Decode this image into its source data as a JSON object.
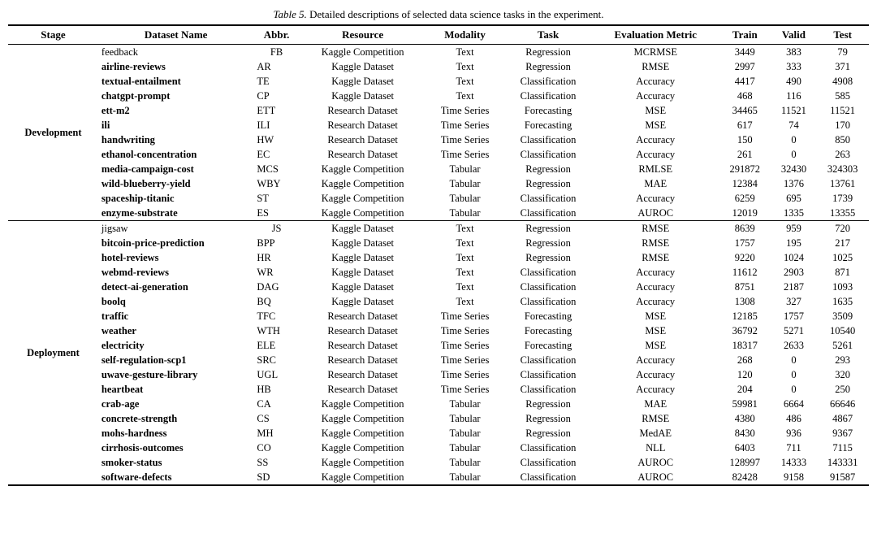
{
  "caption": {
    "table_num": "Table 5.",
    "description": "Detailed descriptions of selected data science tasks in the experiment."
  },
  "headers": [
    "Stage",
    "Dataset Name",
    "Abbr.",
    "Resource",
    "Modality",
    "Task",
    "Evaluation Metric",
    "Train",
    "Valid",
    "Test"
  ],
  "development_rows": [
    [
      "feedback",
      "FB",
      "Kaggle Competition",
      "Text",
      "Regression",
      "MCRMSE",
      "3449",
      "383",
      "79"
    ],
    [
      "airline-reviews",
      "AR",
      "Kaggle Dataset",
      "Text",
      "Regression",
      "RMSE",
      "2997",
      "333",
      "371"
    ],
    [
      "textual-entailment",
      "TE",
      "Kaggle Dataset",
      "Text",
      "Classification",
      "Accuracy",
      "4417",
      "490",
      "4908"
    ],
    [
      "chatgpt-prompt",
      "CP",
      "Kaggle Dataset",
      "Text",
      "Classification",
      "Accuracy",
      "468",
      "116",
      "585"
    ],
    [
      "ett-m2",
      "ETT",
      "Research Dataset",
      "Time Series",
      "Forecasting",
      "MSE",
      "34465",
      "11521",
      "11521"
    ],
    [
      "ili",
      "ILI",
      "Research Dataset",
      "Time Series",
      "Forecasting",
      "MSE",
      "617",
      "74",
      "170"
    ],
    [
      "handwriting",
      "HW",
      "Research Dataset",
      "Time Series",
      "Classification",
      "Accuracy",
      "150",
      "0",
      "850"
    ],
    [
      "ethanol-concentration",
      "EC",
      "Research Dataset",
      "Time Series",
      "Classification",
      "Accuracy",
      "261",
      "0",
      "263"
    ],
    [
      "media-campaign-cost",
      "MCS",
      "Kaggle Competition",
      "Tabular",
      "Regression",
      "RMLSE",
      "291872",
      "32430",
      "324303"
    ],
    [
      "wild-blueberry-yield",
      "WBY",
      "Kaggle Competition",
      "Tabular",
      "Regression",
      "MAE",
      "12384",
      "1376",
      "13761"
    ],
    [
      "spaceship-titanic",
      "ST",
      "Kaggle Competition",
      "Tabular",
      "Classification",
      "Accuracy",
      "6259",
      "695",
      "1739"
    ],
    [
      "enzyme-substrate",
      "ES",
      "Kaggle Competition",
      "Tabular",
      "Classification",
      "AUROC",
      "12019",
      "1335",
      "13355"
    ]
  ],
  "deployment_rows": [
    [
      "jigsaw",
      "JS",
      "Kaggle Dataset",
      "Text",
      "Regression",
      "RMSE",
      "8639",
      "959",
      "720"
    ],
    [
      "bitcoin-price-prediction",
      "BPP",
      "Kaggle Dataset",
      "Text",
      "Regression",
      "RMSE",
      "1757",
      "195",
      "217"
    ],
    [
      "hotel-reviews",
      "HR",
      "Kaggle Dataset",
      "Text",
      "Regression",
      "RMSE",
      "9220",
      "1024",
      "1025"
    ],
    [
      "webmd-reviews",
      "WR",
      "Kaggle Dataset",
      "Text",
      "Classification",
      "Accuracy",
      "11612",
      "2903",
      "871"
    ],
    [
      "detect-ai-generation",
      "DAG",
      "Kaggle Dataset",
      "Text",
      "Classification",
      "Accuracy",
      "8751",
      "2187",
      "1093"
    ],
    [
      "boolq",
      "BQ",
      "Kaggle Dataset",
      "Text",
      "Classification",
      "Accuracy",
      "1308",
      "327",
      "1635"
    ],
    [
      "traffic",
      "TFC",
      "Research Dataset",
      "Time Series",
      "Forecasting",
      "MSE",
      "12185",
      "1757",
      "3509"
    ],
    [
      "weather",
      "WTH",
      "Research Dataset",
      "Time Series",
      "Forecasting",
      "MSE",
      "36792",
      "5271",
      "10540"
    ],
    [
      "electricity",
      "ELE",
      "Research Dataset",
      "Time Series",
      "Forecasting",
      "MSE",
      "18317",
      "2633",
      "5261"
    ],
    [
      "self-regulation-scp1",
      "SRC",
      "Research Dataset",
      "Time Series",
      "Classification",
      "Accuracy",
      "268",
      "0",
      "293"
    ],
    [
      "uwave-gesture-library",
      "UGL",
      "Research Dataset",
      "Time Series",
      "Classification",
      "Accuracy",
      "120",
      "0",
      "320"
    ],
    [
      "heartbeat",
      "HB",
      "Research Dataset",
      "Time Series",
      "Classification",
      "Accuracy",
      "204",
      "0",
      "250"
    ],
    [
      "crab-age",
      "CA",
      "Kaggle Competition",
      "Tabular",
      "Regression",
      "MAE",
      "59981",
      "6664",
      "66646"
    ],
    [
      "concrete-strength",
      "CS",
      "Kaggle Competition",
      "Tabular",
      "Regression",
      "RMSE",
      "4380",
      "486",
      "4867"
    ],
    [
      "mohs-hardness",
      "MH",
      "Kaggle Competition",
      "Tabular",
      "Regression",
      "MedAE",
      "8430",
      "936",
      "9367"
    ],
    [
      "cirrhosis-outcomes",
      "CO",
      "Kaggle Competition",
      "Tabular",
      "Classification",
      "NLL",
      "6403",
      "711",
      "7115"
    ],
    [
      "smoker-status",
      "SS",
      "Kaggle Competition",
      "Tabular",
      "Classification",
      "AUROC",
      "128997",
      "14333",
      "143331"
    ],
    [
      "software-defects",
      "SD",
      "Kaggle Competition",
      "Tabular",
      "Classification",
      "AUROC",
      "82428",
      "9158",
      "91587"
    ]
  ],
  "stages": {
    "development": "Development",
    "deployment": "Deployment"
  }
}
